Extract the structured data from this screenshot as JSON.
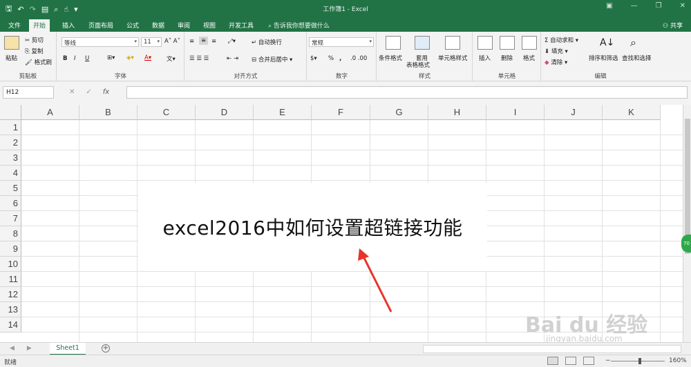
{
  "window": {
    "title": "工作簿1  -  Excel"
  },
  "tabs": [
    {
      "label": "文件"
    },
    {
      "label": "开始"
    },
    {
      "label": "插入"
    },
    {
      "label": "页面布局"
    },
    {
      "label": "公式"
    },
    {
      "label": "数据"
    },
    {
      "label": "审阅"
    },
    {
      "label": "视图"
    },
    {
      "label": "开发工具"
    }
  ],
  "tell_me": "告诉我你想要做什么",
  "share": "共享",
  "ribbon": {
    "clipboard": {
      "paste": "粘贴",
      "cut": "剪切",
      "copy": "复制",
      "format_painter": "格式刷",
      "label": "剪贴板"
    },
    "font": {
      "name": "等线",
      "size": "11",
      "label": "字体",
      "bold": "B",
      "italic": "I",
      "underline": "U"
    },
    "alignment": {
      "wrap": "自动换行",
      "merge": "合并后居中",
      "label": "对齐方式"
    },
    "number": {
      "format": "常规",
      "percent": "%",
      "comma": ",",
      "label": "数字"
    },
    "styles": {
      "conditional": "条件格式",
      "table_format_1": "套用",
      "table_format_2": "表格格式",
      "cell_styles": "单元格样式",
      "label": "样式"
    },
    "cells": {
      "insert": "插入",
      "delete": "删除",
      "format": "格式",
      "label": "单元格"
    },
    "editing": {
      "autosum": "自动求和",
      "fill": "填充",
      "clear": "清除",
      "sort": "排序和筛选",
      "find": "查找和选择",
      "label": "编辑"
    }
  },
  "formula_bar": {
    "name_box": "H12",
    "fx": "fx",
    "value": ""
  },
  "columns": [
    "A",
    "B",
    "C",
    "D",
    "E",
    "F",
    "G",
    "H",
    "I",
    "J",
    "K"
  ],
  "rows": [
    "1",
    "2",
    "3",
    "4",
    "5",
    "6",
    "7",
    "8",
    "9",
    "10",
    "11",
    "12",
    "13",
    "14"
  ],
  "textbox": {
    "text": "excel2016中如何设置超链接功能"
  },
  "sheets": [
    {
      "name": "Sheet1"
    }
  ],
  "status": {
    "ready": "就绪",
    "zoom": "160%"
  },
  "watermark": {
    "brand": "Bai du 经验",
    "url": "jingyan.baidu.com"
  },
  "colors": {
    "excel_green": "#217346",
    "arrow_red": "#e8332b"
  }
}
